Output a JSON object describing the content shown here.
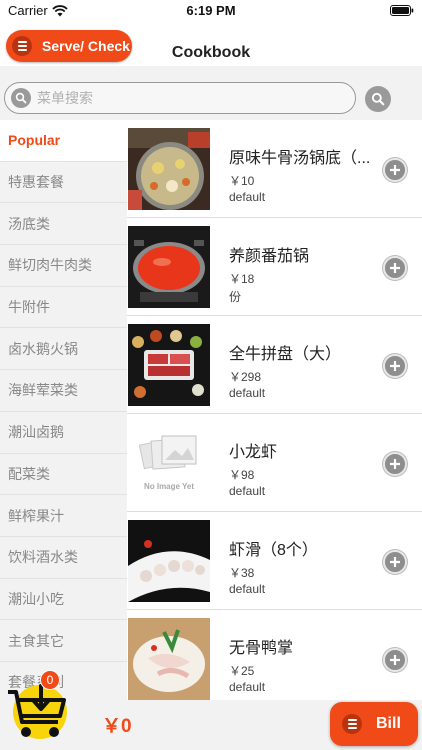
{
  "status_bar": {
    "carrier": "Carrier",
    "time": "6:19 PM"
  },
  "nav": {
    "serve_label": "Serve/ Check",
    "title": "Cookbook"
  },
  "search": {
    "placeholder": "菜单搜索"
  },
  "categories": [
    "Popular",
    "特惠套餐",
    "汤底类",
    "鲜切肉牛肉类",
    "牛附件",
    "卤水鹅火锅",
    "海鲜荤菜类",
    "潮汕卤鹅",
    "配菜类",
    "鲜榨果汁",
    "饮料酒水类",
    "潮汕小吃",
    "主食其它",
    "套餐系列"
  ],
  "active_category": "Popular",
  "dishes": [
    {
      "name": "原味牛骨汤锅底（...",
      "price": "￥10",
      "spec": "default",
      "image": "hotpot-broth"
    },
    {
      "name": "养颜番茄锅",
      "price": "￥18",
      "spec": "份",
      "image": "tomato-pot"
    },
    {
      "name": "全牛拼盘（大）",
      "price": "￥298",
      "spec": "default",
      "image": "beef-platter"
    },
    {
      "name": "小龙虾",
      "price": "￥98",
      "spec": "default",
      "image": "no-image",
      "no_image_text": "No Image Yet"
    },
    {
      "name": "虾滑（8个）",
      "price": "￥38",
      "spec": "default",
      "image": "shrimp-paste"
    },
    {
      "name": "无骨鸭掌",
      "price": "￥25",
      "spec": "default",
      "image": "duck-feet"
    }
  ],
  "cart": {
    "count": "0",
    "total": "￥0"
  },
  "bill_label": "Bill",
  "colors": {
    "accent": "#f04a18",
    "sidebar_bg": "#f2f2f2",
    "inactive_text": "#888888"
  }
}
